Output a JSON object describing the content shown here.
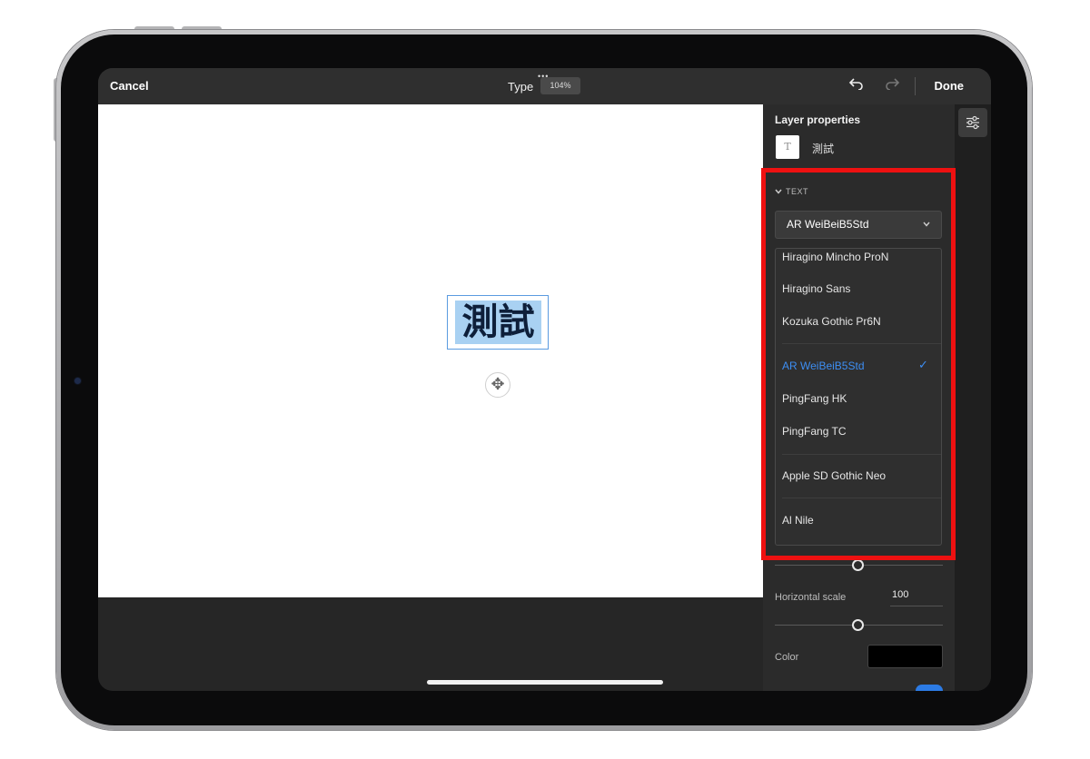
{
  "topbar": {
    "cancel_label": "Cancel",
    "more_icon": "ellipsis-icon",
    "mode_label": "Type",
    "zoom_label": "104%",
    "undo_icon": "undo-icon",
    "redo_icon": "redo-icon",
    "done_label": "Done"
  },
  "canvas": {
    "text_content": "測試",
    "move_icon": "move-icon",
    "text_highlight_color": "#a9d1f2"
  },
  "panel": {
    "title": "Layer properties",
    "layer_icon_glyph": "T",
    "layer_name": "測試",
    "section_label": "TEXT",
    "selected_font": "AR WeiBeiB5Std",
    "font_options": [
      {
        "name": "Hiragino Mincho ProN",
        "selected": false
      },
      {
        "name": "Hiragino Sans",
        "selected": false
      },
      {
        "name": "Kozuka Gothic Pr6N",
        "selected": false
      },
      {
        "name": "AR WeiBeiB5Std",
        "selected": true
      },
      {
        "name": "PingFang HK",
        "selected": false
      },
      {
        "name": "PingFang TC",
        "selected": false
      },
      {
        "name": "Apple SD Gothic Neo",
        "selected": false
      },
      {
        "name": "Al Nile",
        "selected": false
      }
    ],
    "horizontal_scale_label": "Horizontal scale",
    "horizontal_scale_value": "100",
    "color_label": "Color",
    "color_value": "#000000",
    "accent_color": "#3d8ef3"
  },
  "rail": {
    "settings_icon": "sliders-icon"
  }
}
